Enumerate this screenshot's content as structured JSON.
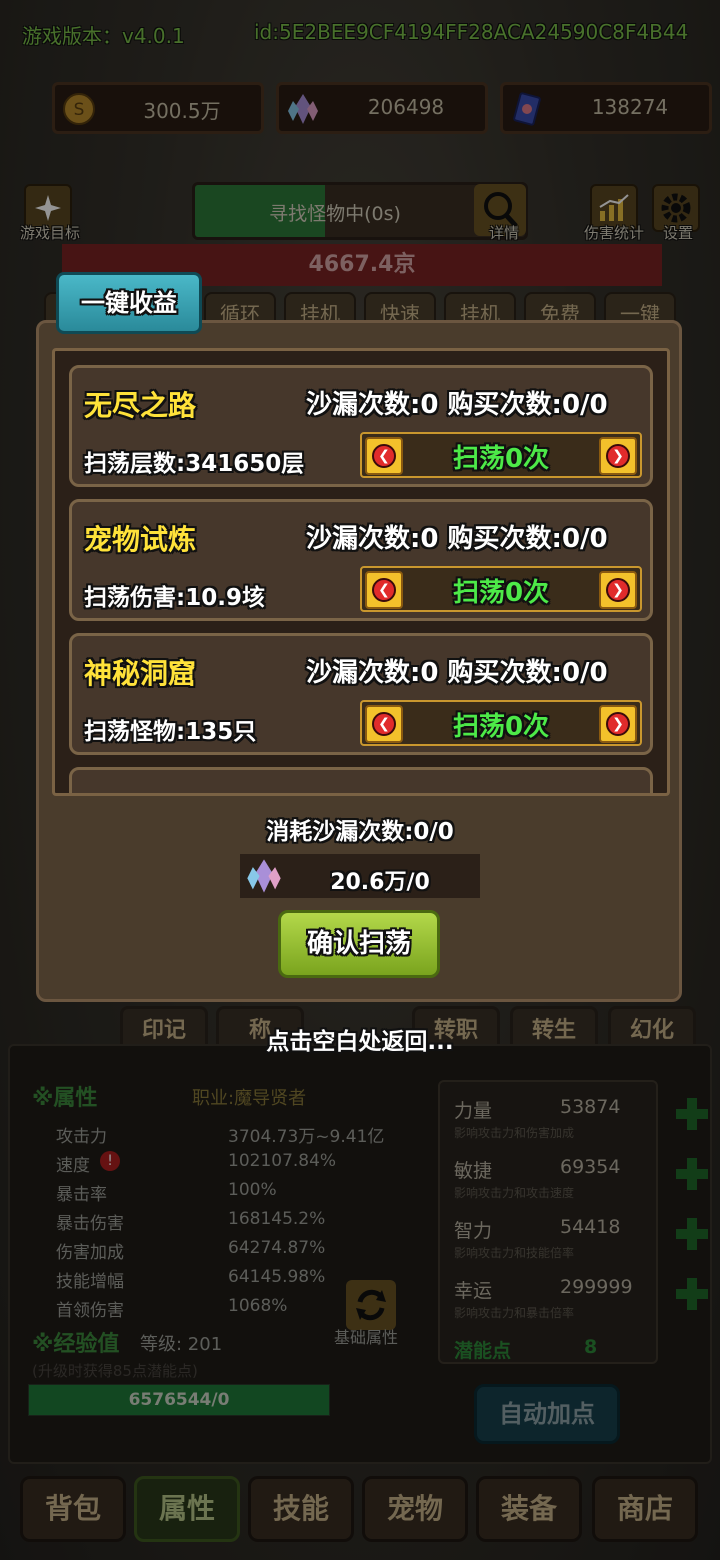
{
  "header": {
    "version": "游戏版本：v4.0.1",
    "user_id": "id:5E2BEE9CF4194FF28ACA24590C8F4B44"
  },
  "resources": {
    "gold": "300.5万",
    "crystal": "206498",
    "card": "138274"
  },
  "toolbar": {
    "game_goal": "游戏目标",
    "search_status": "寻找怪物中(0s)",
    "detail": "详情",
    "damage_stats": "伤害统计",
    "settings": "设置"
  },
  "enemy_hp": "4667.4京",
  "tabs": [
    "一键收益",
    "循环",
    "挂机",
    "快速",
    "挂机",
    "免费",
    "一键"
  ],
  "dialog": {
    "rows": [
      {
        "name": "无尽之路",
        "counts": "沙漏次数:0   购买次数:0/0",
        "desc": "扫荡层数:341650层",
        "sweep": "扫荡0次"
      },
      {
        "name": "宠物试炼",
        "counts": "沙漏次数:0   购买次数:0/0",
        "desc": "扫荡伤害:10.9垓",
        "sweep": "扫荡0次"
      },
      {
        "name": "神秘洞窟",
        "counts": "沙漏次数:0   购买次数:0/0",
        "desc": "扫荡怪物:135只",
        "sweep": "扫荡0次"
      }
    ],
    "consume": "消耗沙漏次数:0/0",
    "cost": "20.6万/0",
    "confirm": "确认扫荡",
    "hint": "点击空白处返回..."
  },
  "subtabs": [
    "印记",
    "称",
    "转职",
    "转生",
    "幻化"
  ],
  "attributes": {
    "section": "※属性",
    "job": "职业:魔导贤者",
    "list": [
      {
        "label": "攻击力",
        "value": "3704.73万~9.41亿"
      },
      {
        "label": "速度",
        "value": "102107.84%"
      },
      {
        "label": "暴击率",
        "value": "100%"
      },
      {
        "label": "暴击伤害",
        "value": "168145.2%"
      },
      {
        "label": "伤害加成",
        "value": "64274.87%"
      },
      {
        "label": "技能增幅",
        "value": "64145.98%"
      },
      {
        "label": "首领伤害",
        "value": "1068%"
      }
    ],
    "base_attr": "基础属性",
    "exp_title": "※经验值",
    "level": "等级: 201",
    "exp_hint": "(升级时获得85点潜能点)",
    "exp_bar": "6576544/0",
    "exp_fill": 1.0
  },
  "stats": [
    {
      "name": "力量",
      "value": "53874",
      "desc": "影响攻击力和伤害加成"
    },
    {
      "name": "敏捷",
      "value": "69354",
      "desc": "影响攻击力和攻击速度"
    },
    {
      "name": "智力",
      "value": "54418",
      "desc": "影响攻击力和技能倍率"
    },
    {
      "name": "幸运",
      "value": "299999",
      "desc": "影响攻击力和暴击倍率"
    }
  ],
  "potential": {
    "label": "潜能点",
    "value": "8"
  },
  "auto_add": "自动加点",
  "bottom_nav": [
    "背包",
    "属性",
    "技能",
    "宠物",
    "装备",
    "商店"
  ],
  "colors": {
    "accent_green": "#4dea48",
    "title_yellow": "#ffe23a",
    "hp_red": "#7a2424"
  }
}
